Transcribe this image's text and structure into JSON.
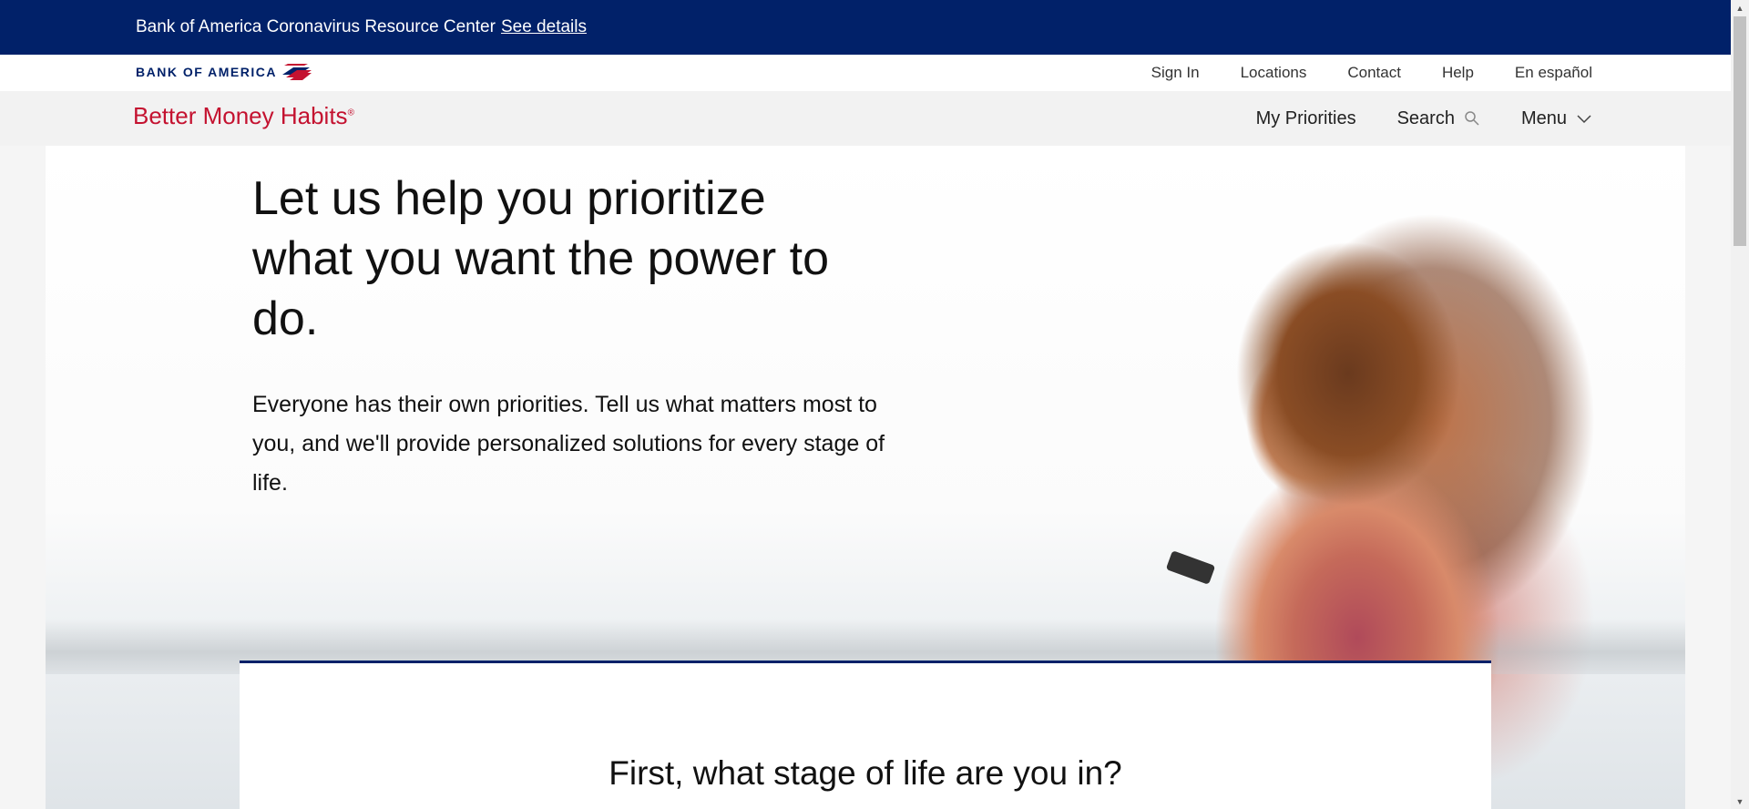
{
  "banner": {
    "text": "Bank of America Coronavirus Resource Center",
    "link": "See details"
  },
  "utility": {
    "logo_text": "BANK OF AMERICA",
    "links": [
      "Sign In",
      "Locations",
      "Contact",
      "Help",
      "En español"
    ]
  },
  "subnav": {
    "brand": "Better Money Habits",
    "brand_mark": "®",
    "my_priorities": "My Priorities",
    "search": "Search",
    "menu": "Menu"
  },
  "hero": {
    "headline": "Let us help you prioritize what you want the power to do.",
    "subtext": "Everyone has their own priorities. Tell us what matters most to you, and we'll provide personalized solutions for every stage of life."
  },
  "card": {
    "title": "First, what stage of life are you in?"
  },
  "colors": {
    "banner_bg": "#012169",
    "brand_red": "#c41230",
    "card_border": "#012169"
  },
  "icons": {
    "logo_flag": "flag-icon",
    "search": "search-icon",
    "menu": "chevron-down-icon"
  }
}
